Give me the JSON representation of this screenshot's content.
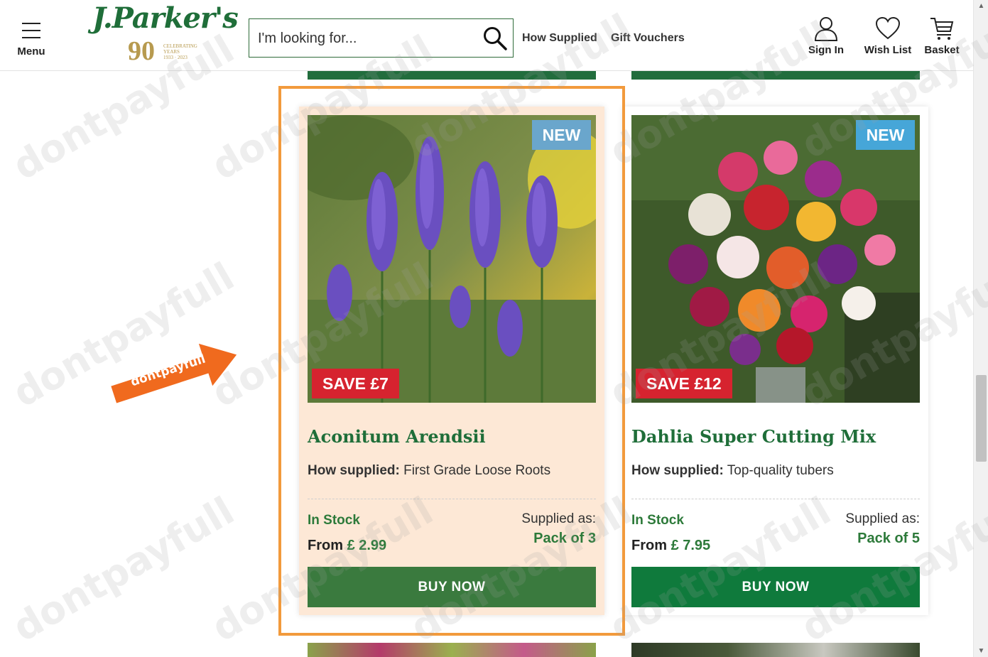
{
  "header": {
    "menu_label": "Menu",
    "logo": {
      "script_text": "J.Parker's",
      "number": "90",
      "sub_lines": [
        "CELEBRATING",
        "YEARS",
        "1933 · 2023"
      ]
    },
    "search": {
      "placeholder": "I'm looking for...",
      "value": ""
    },
    "nav": [
      "How Supplied",
      "Gift Vouchers"
    ],
    "account": {
      "sign_in": "Sign In",
      "wish_list": "Wish List",
      "basket": "Basket"
    }
  },
  "products": [
    {
      "badge": "NEW",
      "save": "SAVE £7",
      "title": "Aconitum Arendsii",
      "supplied_label": "How supplied:",
      "supplied_value": "First Grade Loose Roots",
      "stock": "In Stock",
      "from_label": "From",
      "price": "£ 2.99",
      "supplied_as_label": "Supplied as:",
      "supplied_as_value": "Pack of 3",
      "buy_label": "BUY NOW"
    },
    {
      "badge": "NEW",
      "save": "SAVE £12",
      "title": "Dahlia Super Cutting Mix",
      "supplied_label": "How supplied:",
      "supplied_value": "Top-quality tubers",
      "stock": "In Stock",
      "from_label": "From",
      "price": "£ 7.95",
      "supplied_as_label": "Supplied as:",
      "supplied_as_value": "Pack of 5",
      "buy_label": "BUY NOW"
    }
  ],
  "overlay": {
    "arrow_text": "dontpayfull",
    "watermark": "dontpayfull"
  },
  "colors": {
    "brand_green": "#1f6e39",
    "buy_green": "#0f7a3c",
    "save_red": "#d6232f",
    "new_blue": "#6aa6cc",
    "highlight_orange": "#f29a3c"
  }
}
